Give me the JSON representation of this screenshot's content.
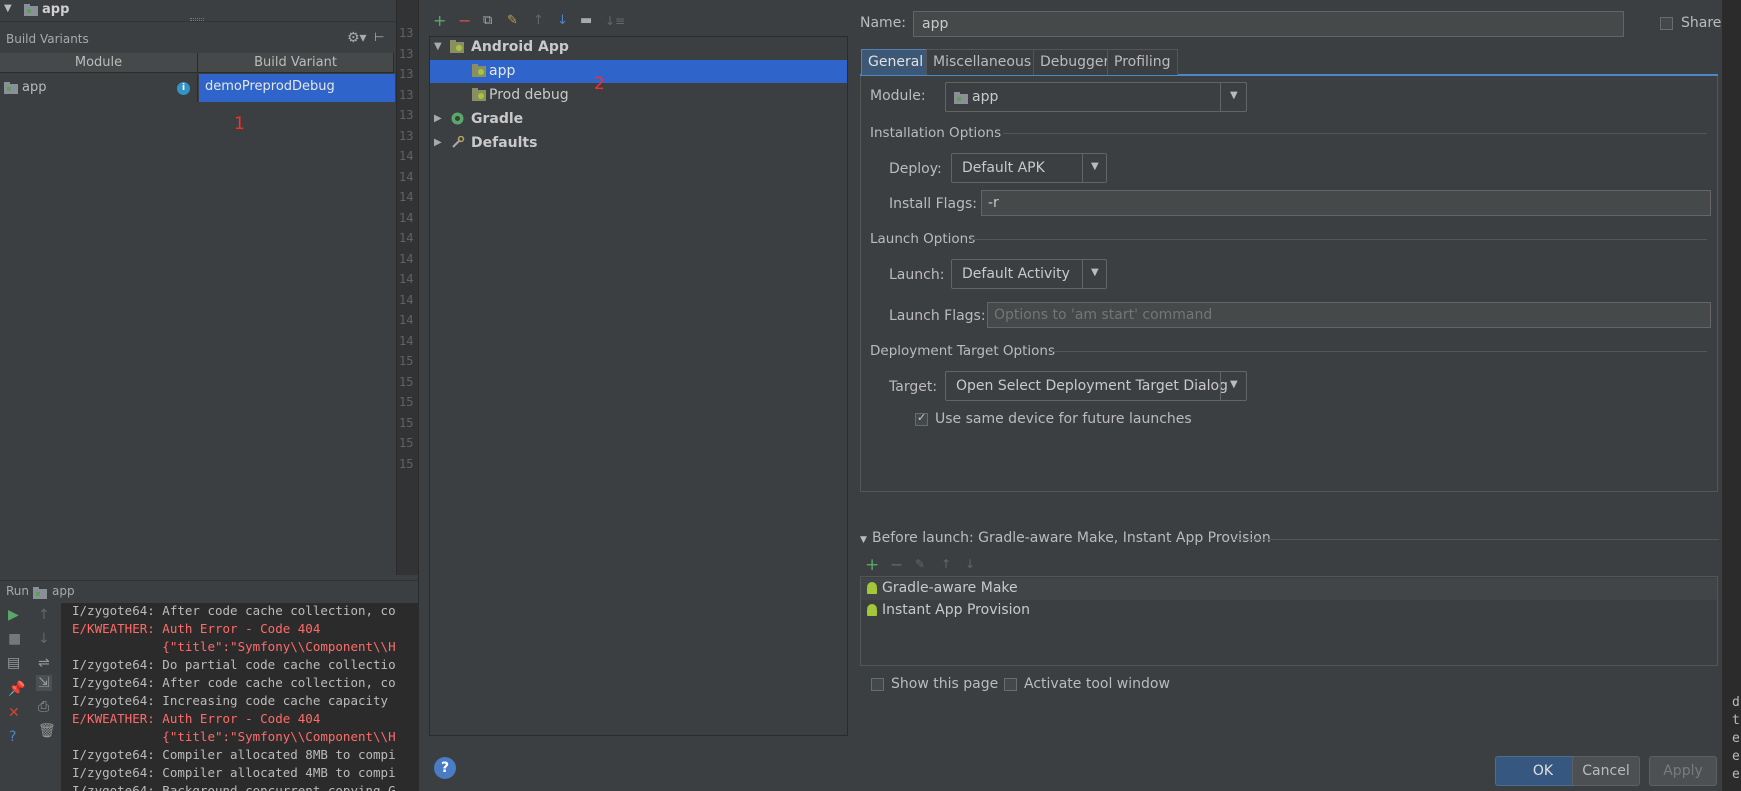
{
  "project": {
    "arrow": "▼",
    "label": "app"
  },
  "build_variants": {
    "title": "Build Variants",
    "columns": [
      "Module",
      "Build Variant"
    ],
    "row": {
      "module": "app",
      "variant": "demoPreprodDebug"
    }
  },
  "annotations": {
    "one": "1",
    "two": "2"
  },
  "gutter_numbers": [
    "13",
    "13",
    "13",
    "13",
    "13",
    "13",
    "14",
    "14",
    "14",
    "14",
    "14",
    "14",
    "14",
    "14",
    "14",
    "14",
    "15",
    "15",
    "15",
    "15",
    "15",
    "15"
  ],
  "run": {
    "label": "Run",
    "config": "app",
    "lines": [
      {
        "text": "I/zygote64: After code cache collection, co",
        "kind": "info"
      },
      {
        "text": "E/KWEATHER: Auth Error - Code 404",
        "kind": "error"
      },
      {
        "text": "            {\"title\":\"Symfony\\\\Component\\\\H",
        "kind": "error"
      },
      {
        "text": "I/zygote64: Do partial code cache collectio",
        "kind": "info"
      },
      {
        "text": "I/zygote64: After code cache collection, co",
        "kind": "info"
      },
      {
        "text": "I/zygote64: Increasing code cache capacity ",
        "kind": "info"
      },
      {
        "text": "E/KWEATHER: Auth Error - Code 404",
        "kind": "error"
      },
      {
        "text": "            {\"title\":\"Symfony\\\\Component\\\\H",
        "kind": "error"
      },
      {
        "text": "I/zygote64: Compiler allocated 8MB to compi",
        "kind": "info"
      },
      {
        "text": "I/zygote64: Compiler allocated 4MB to compi",
        "kind": "info"
      },
      {
        "text": "I/zygote64: Background concurrent copying G",
        "kind": "info"
      }
    ]
  },
  "tree": {
    "items": [
      {
        "label": "Android App",
        "expanded": true
      },
      {
        "label": "app",
        "selected": true
      },
      {
        "label": "Prod debug"
      },
      {
        "label": "Gradle",
        "expanded": false
      },
      {
        "label": "Defaults",
        "expanded": false
      }
    ],
    "help": "?"
  },
  "config": {
    "name_label": "Name:",
    "name_value": "app",
    "share_label": "Share",
    "tabs": [
      "General",
      "Miscellaneous",
      "Debugger",
      "Profiling"
    ],
    "module_label": "Module:",
    "module_value": "app",
    "installation_title": "Installation Options",
    "deploy_label": "Deploy:",
    "deploy_value": "Default APK",
    "install_flags_label": "Install Flags:",
    "install_flags_value": "-r",
    "launch_title": "Launch Options",
    "launch_label": "Launch:",
    "launch_value": "Default Activity",
    "launch_flags_label": "Launch Flags:",
    "launch_flags_placeholder": "Options to 'am start' command",
    "deployment_title": "Deployment Target Options",
    "target_label": "Target:",
    "target_value": "Open Select Deployment Target Dialog",
    "same_device_label": "Use same device for future launches",
    "same_device_checked": true
  },
  "before_launch": {
    "label": "Before launch: Gradle-aware Make, Instant App Provision",
    "items": [
      "Gradle-aware Make",
      "Instant App Provision"
    ],
    "show_page_label": "Show this page",
    "activate_label": "Activate tool window"
  },
  "buttons": {
    "ok": "OK",
    "cancel": "Cancel",
    "apply": "Apply"
  },
  "edge_chars": [
    "d",
    "t",
    "e",
    "e",
    "e"
  ],
  "colors": {
    "selection": "#2f65ca",
    "error": "#ff6b68",
    "accent": "#4a88c7"
  }
}
